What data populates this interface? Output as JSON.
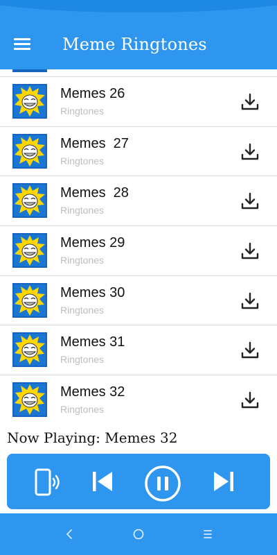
{
  "app_bar": {
    "title": "Meme Ringtones",
    "menu_icon": "hamburger-menu-icon",
    "color": "#2f96f0"
  },
  "ringtones": [
    {
      "title": "Memes 26",
      "subtitle": "Ringtones"
    },
    {
      "title": "Memes  27",
      "subtitle": "Ringtones"
    },
    {
      "title": "Memes  28",
      "subtitle": "Ringtones"
    },
    {
      "title": "Memes 29",
      "subtitle": "Ringtones"
    },
    {
      "title": "Memes 30",
      "subtitle": "Ringtones"
    },
    {
      "title": "Memes 31",
      "subtitle": "Ringtones"
    },
    {
      "title": "Memes 32",
      "subtitle": "Ringtones"
    }
  ],
  "row_icons": {
    "thumbnail": "troll-face-thumbnail-icon",
    "download": "download-icon"
  },
  "now_playing": {
    "text": "Now Playing: Memes 32"
  },
  "player": {
    "buttons": [
      "set-ringtone-phone-icon",
      "skip-previous-icon",
      "pause-icon",
      "skip-next-icon"
    ],
    "color": "#2f96f0"
  },
  "system_nav": {
    "buttons": [
      "back-icon",
      "home-icon",
      "recent-apps-icon"
    ]
  },
  "colors": {
    "accent": "#2f96f0",
    "subtitle": "#bdbdbd",
    "divider": "#d8d8d8"
  }
}
